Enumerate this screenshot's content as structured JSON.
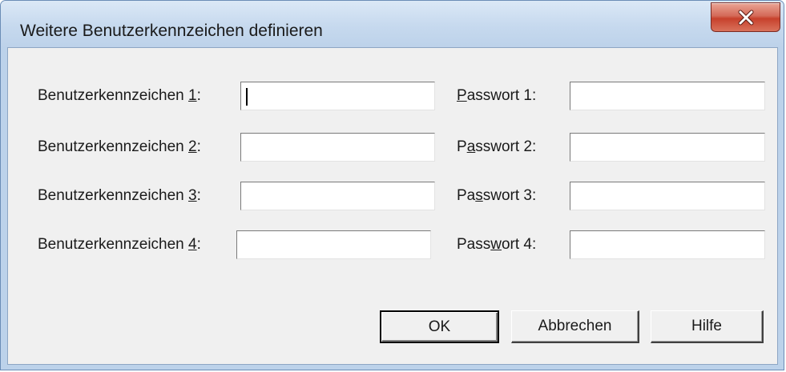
{
  "window": {
    "title": "Weitere Benutzerkennzeichen definieren",
    "close_label": "X"
  },
  "rows": [
    {
      "user_prefix": "Benutzerkennzeichen ",
      "user_key": "1",
      "user_suffix": ":",
      "user_value": "",
      "pw_prefix": "",
      "pw_key": "P",
      "pw_suffix": "asswort 1:",
      "pw_value": ""
    },
    {
      "user_prefix": "Benutzerkennzeichen ",
      "user_key": "2",
      "user_suffix": ":",
      "user_value": "",
      "pw_prefix": "P",
      "pw_key": "a",
      "pw_suffix": "sswort 2:",
      "pw_value": ""
    },
    {
      "user_prefix": "Benutzerkennzeichen ",
      "user_key": "3",
      "user_suffix": ":",
      "user_value": "",
      "pw_prefix": "Pa",
      "pw_key": "s",
      "pw_suffix": "swort 3:",
      "pw_value": ""
    },
    {
      "user_prefix": "Benutzerkennzeichen ",
      "user_key": "4",
      "user_suffix": ":",
      "user_value": "",
      "pw_prefix": "Pass",
      "pw_key": "w",
      "pw_suffix": "ort 4:",
      "pw_value": ""
    }
  ],
  "buttons": {
    "ok": "OK",
    "cancel": "Abbrechen",
    "help": "Hilfe"
  }
}
